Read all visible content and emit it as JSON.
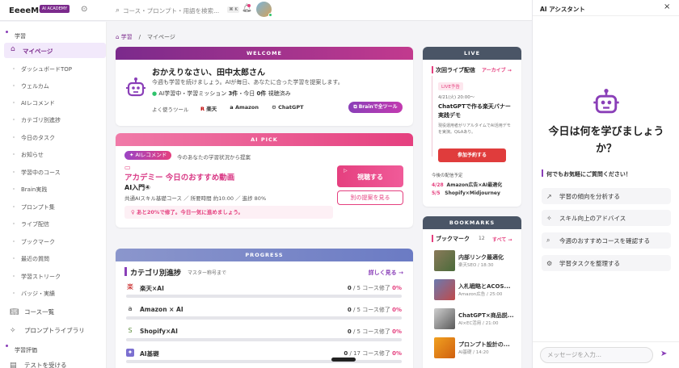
{
  "topbar": {
    "logo": "EeeeMO",
    "logo_badge": "AI ACADEMY",
    "search_placeholder": "コース・プロンプト・用語を検索...",
    "search_shortcut": "⌘ K"
  },
  "sidebar": {
    "section_learning": "学習",
    "active_item": "マイページ",
    "items": [
      "ダッシュボードTOP",
      "ウェルカム",
      "AIレコメンド",
      "カテゴリ別進捗",
      "今日のタスク",
      "お知らせ",
      "学習中のコース",
      "Brain実践",
      "プロンプト集",
      "ライブ配信",
      "ブックマーク",
      "最近の質問",
      "学習ストリーク",
      "バッジ・実績"
    ],
    "main_items": [
      "コース一覧",
      "プロンプトライブラリ"
    ],
    "section_eval": "学習評価",
    "eval_items": [
      "テストを受ける"
    ]
  },
  "breadcrumb": {
    "home": "学習",
    "sep": "/",
    "current": "マイページ"
  },
  "welcome": {
    "header": "WELCOME",
    "greeting": "おかえりなさい、田中太郎さん",
    "message": "今週も学習を続けましょう。AIが毎日、あなたに合った学習を提案します。",
    "status_prefix": "AI学習中・学習ミッション",
    "missions": "3件",
    "today_label": "・今日",
    "today_count": "0件",
    "viewed": "視聴済み",
    "tools_label": "よく使うツール",
    "tools": [
      "楽天",
      "Amazon",
      "ChatGPT"
    ],
    "brain_button": "Brainで全ツール"
  },
  "ai_pick": {
    "header": "AI PICK",
    "badge": "AIレコメンド",
    "intro": "今のあなたの学習状況から提案",
    "title": "アカデミー 今日のおすすめ動画",
    "course": "AI入門④",
    "meta": "共通AIスキル基礎コース ／ 所要時間 約10:00 ／ 進捗 80%",
    "watch_button": "視聴する",
    "other_button": "別の提案を見る",
    "hint": "あと20%で修了。今日一気に進めましょう。"
  },
  "progress": {
    "header": "PROGRESS",
    "title": "カテゴリ別進捗",
    "subtitle": "マスター称号まで",
    "more": "詳しく見る →",
    "rows": [
      {
        "icon": "楽",
        "label": "楽天×AI",
        "done": "0",
        "total": "/ 5 コース修了",
        "pct": "0%",
        "fill": 0
      },
      {
        "icon": "a",
        "label": "Amazon × AI",
        "done": "0",
        "total": "/ 5 コース修了",
        "pct": "0%",
        "fill": 0
      },
      {
        "icon": "S",
        "label": "Shopify×AI",
        "done": "0",
        "total": "/ 5 コース修了",
        "pct": "0%",
        "fill": 0
      },
      {
        "icon": "✦",
        "label": "AI基礎",
        "done": "0",
        "total": "/ 17 コース修了",
        "pct": "0%",
        "fill": 0
      }
    ]
  },
  "live": {
    "header": "LIVE",
    "title": "次回ライブ配信",
    "archive": "アーカイブ →",
    "badge": "LIVE予告",
    "datetime": "4/21(火) 20:00〜",
    "event_title": "ChatGPTで作る楽天バナー実践デモ",
    "description": "現役運用者がリアルタイムでAI活用デモを実演。Q&Aあり。",
    "join_button": "参加予約する",
    "upcoming_label": "今後の配信予定",
    "upcoming": [
      {
        "date": "4/28",
        "title": "Amazon広告×AI最適化"
      },
      {
        "date": "5/5",
        "title": "Shopify×Midjourney"
      }
    ]
  },
  "bookmarks": {
    "header": "BOOKMARKS",
    "title": "ブックマーク",
    "count": "12",
    "all": "すべて →",
    "items": [
      {
        "title": "内部リンク最適化",
        "sub": "楽天SEO / 18:30"
      },
      {
        "title": "入札戦略とACOS...",
        "sub": "Amazon広告 / 25:00"
      },
      {
        "title": "ChatGPT×商品説...",
        "sub": "AI×EC活用 / 21:00"
      },
      {
        "title": "プロンプト設計の...",
        "sub": "AI基礎 / 14:20"
      }
    ]
  },
  "assistant": {
    "title": "AI アシスタント",
    "heading": "今日は何を学びましょうか？",
    "prompt": "何でもお気軽にご質問ください！",
    "suggestions": [
      "学習の傾向を分析する",
      "スキル向上のアドバイス",
      "今週のおすすめコースを確認する",
      "学習タスクを整理する"
    ],
    "input_placeholder": "メッセージを入力..."
  },
  "colors": {
    "brand": "#7b2a8c",
    "accent": "#e5407f",
    "progress": "#6b7bc4",
    "live": "#3e4a5a"
  }
}
